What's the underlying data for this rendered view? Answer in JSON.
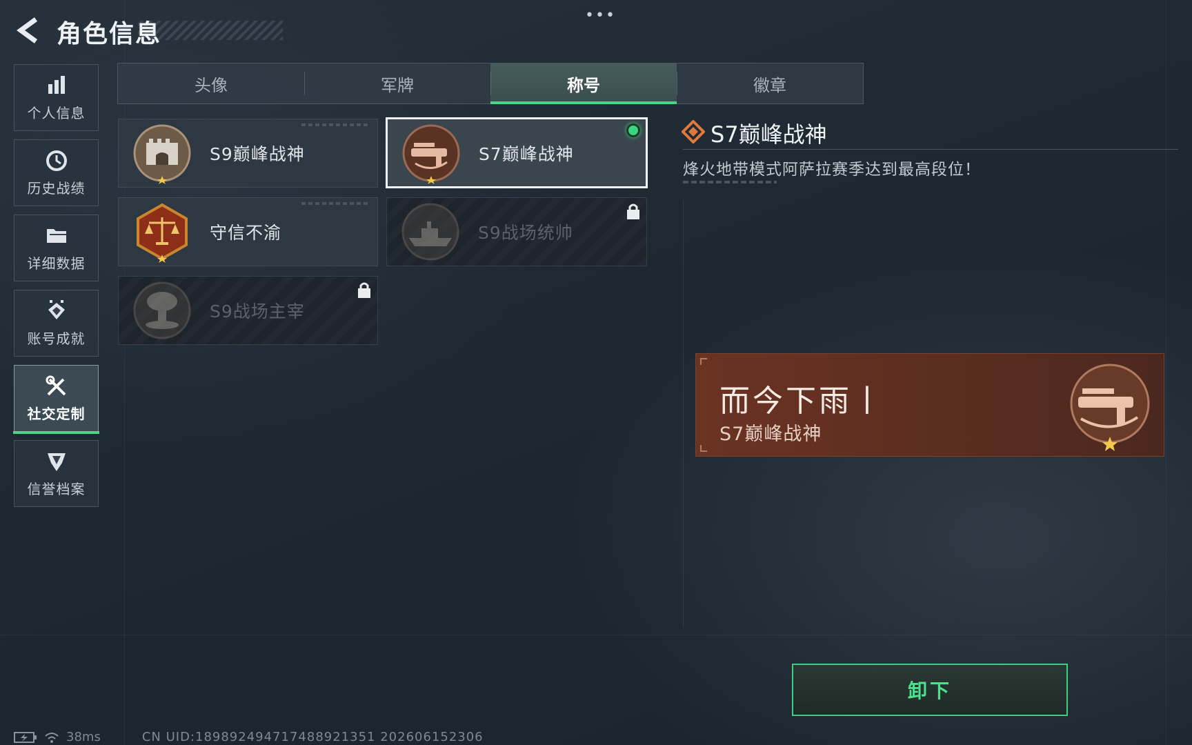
{
  "header": {
    "title": "角色信息",
    "more": "•••"
  },
  "nav": {
    "items": [
      {
        "label": "个人信息",
        "icon": "bar-chart-icon"
      },
      {
        "label": "历史战绩",
        "icon": "clock-icon"
      },
      {
        "label": "详细数据",
        "icon": "folder-icon"
      },
      {
        "label": "账号成就",
        "icon": "medal-icon"
      },
      {
        "label": "社交定制",
        "icon": "tools-icon",
        "active": true
      },
      {
        "label": "信誉档案",
        "icon": "shield-icon"
      }
    ]
  },
  "tabs": [
    {
      "label": "头像"
    },
    {
      "label": "军牌"
    },
    {
      "label": "称号",
      "active": true
    },
    {
      "label": "徽章"
    }
  ],
  "titles": [
    {
      "name": "S9巅峰战神",
      "icon": "fortress-emblem-icon",
      "state": "unlocked"
    },
    {
      "name": "S7巅峰战神",
      "icon": "gun-emblem-icon",
      "state": "equipped"
    },
    {
      "name": "守信不渝",
      "icon": "scales-emblem-icon",
      "state": "unlocked"
    },
    {
      "name": "S9战场统帅",
      "icon": "warship-emblem-icon",
      "state": "locked"
    },
    {
      "name": "S9战场主宰",
      "icon": "mushroom-cloud-emblem-icon",
      "state": "locked"
    }
  ],
  "detail": {
    "title": "S7巅峰战神",
    "description": "烽火地带模式阿萨拉赛季达到最高段位！"
  },
  "nameplate": {
    "player_name": "而今下雨丨",
    "title": "S7巅峰战神"
  },
  "actions": {
    "unequip_label": "卸下"
  },
  "status": {
    "ping": "38ms",
    "uid": "CN UID:18989249471748892135​1 202606152306"
  },
  "colors": {
    "accent": "#4ad68a",
    "nameplate": "#5c2d20",
    "background": "#1e2831"
  }
}
